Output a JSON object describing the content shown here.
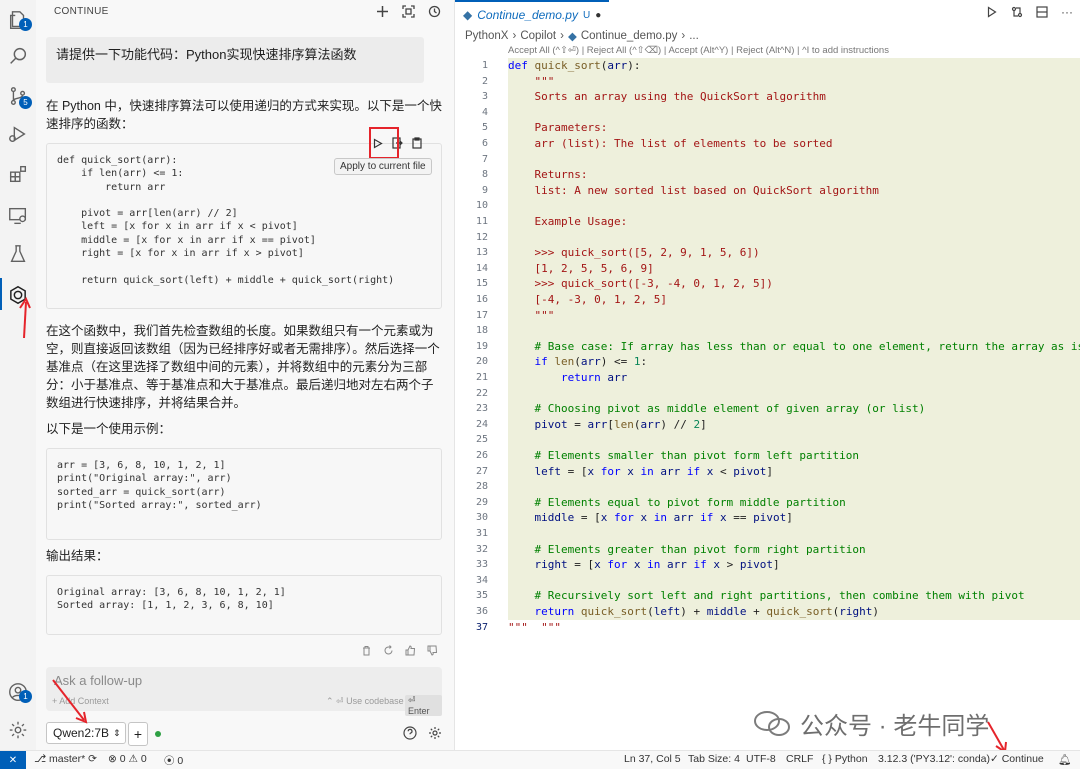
{
  "activity_bar": {
    "items": [
      {
        "name": "explorer-icon",
        "badge": "1"
      },
      {
        "name": "search-icon"
      },
      {
        "name": "source-control-icon",
        "badge": "5"
      },
      {
        "name": "run-debug-icon"
      },
      {
        "name": "extensions-icon"
      },
      {
        "name": "remote-explorer-icon"
      },
      {
        "name": "testing-icon"
      },
      {
        "name": "continue-icon",
        "active": true
      }
    ],
    "account_badge": "1"
  },
  "panel": {
    "title": "CONTINUE",
    "user_message": "请提供一下功能代码：Python实现快速排序算法函数",
    "intro": "在 Python 中，快速排序算法可以使用递归的方式来实现。以下是一个快速排序的函数：",
    "code1": "def quick_sort(arr):\n    if len(arr) <= 1:\n        return arr\n\n    pivot = arr[len(arr) // 2]\n    left = [x for x in arr if x < pivot]\n    middle = [x for x in arr if x == pivot]\n    right = [x for x in arr if x > pivot]\n\n    return quick_sort(left) + middle + quick_sort(right)",
    "tooltip": "Apply to current file",
    "explanation": "在这个函数中，我们首先检查数组的长度。如果数组只有一个元素或为空，则直接返回该数组（因为已经排序好或者无需排序）。然后选择一个基准点（在这里选择了数组中间的元素），并将数组中的元素分为三部分：小于基准点、等于基准点和大于基准点。最后递归地对左右两个子数组进行快速排序，并将结果合并。",
    "example_label": "以下是一个使用示例：",
    "code2": "arr = [3, 6, 8, 10, 1, 2, 1]\nprint(\"Original array:\", arr)\nsorted_arr = quick_sort(arr)\nprint(\"Sorted array:\", sorted_arr)",
    "output_label": "输出结果：",
    "code3": "Original array: [3, 6, 8, 10, 1, 2, 1]\nSorted array: [1, 1, 2, 3, 6, 8, 10]",
    "input_placeholder": "Ask a follow-up",
    "add_context": "+ Add Context",
    "use_codebase": "⌃ ⏎ Use codebase",
    "enter_hint": "⏎ Enter",
    "model": "Qwen2:7B"
  },
  "editor": {
    "tab_name": "Continue_demo.py",
    "tab_status": "U",
    "breadcrumb": [
      "PythonX",
      "Copilot",
      "Continue_demo.py",
      "..."
    ],
    "actions_line": "Accept All (^⇧⏎) | Reject All (^⇧⌫) | Accept (Alt^Y) | Reject (Alt^N) | ^I to add instructions"
  },
  "status_bar": {
    "branch": "master*",
    "errors": "0",
    "warnings": "0",
    "ports": "0",
    "position": "Ln 37, Col 5",
    "tab_size": "Tab Size: 4",
    "encoding": "UTF-8",
    "eol": "CRLF",
    "language": "Python",
    "interpreter": "3.12.3 ('PY3.12': conda)",
    "continue_label": "Continue"
  },
  "watermark": "公众号 · 老牛同学"
}
